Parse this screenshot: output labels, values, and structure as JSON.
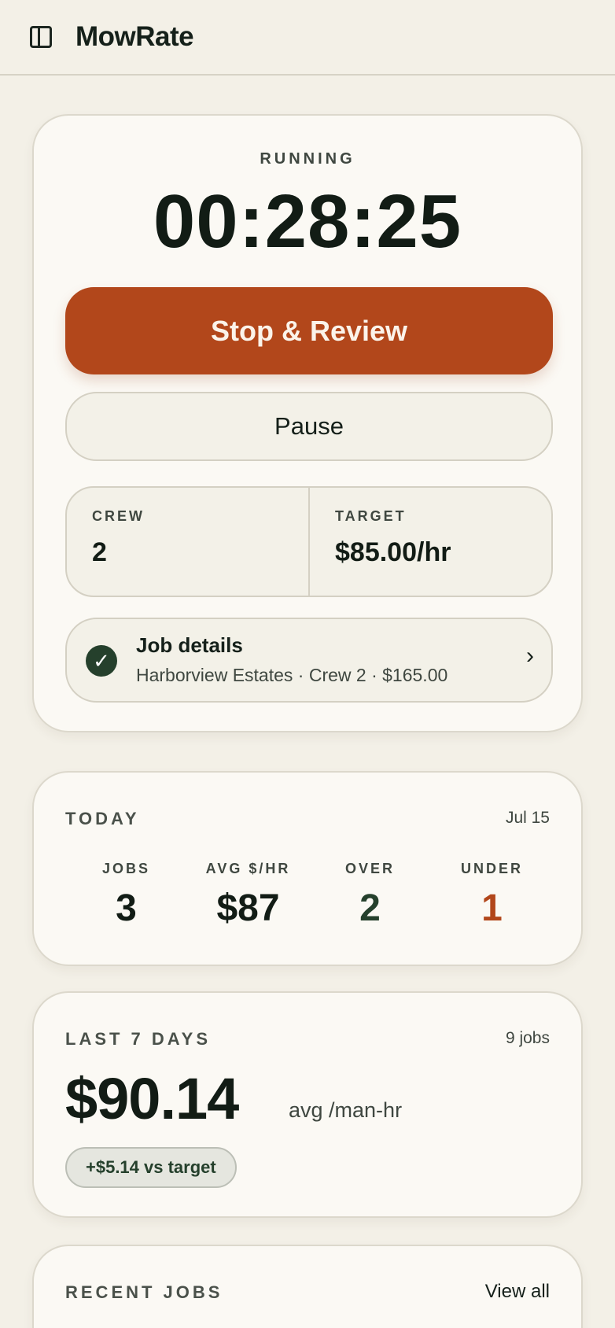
{
  "header": {
    "title": "MowRate",
    "sidebar_icon": "sidebar-toggle-icon"
  },
  "timer": {
    "status": "RUNNING",
    "elapsed": "00:28:25",
    "stop_label": "Stop & Review",
    "pause_label": "Pause",
    "crew_label": "CREW",
    "crew_value": "2",
    "target_label": "TARGET",
    "target_value": "$85.00/hr",
    "job_details": {
      "title": "Job details",
      "subtitle": "Harborview Estates · Crew 2 · $165.00",
      "check_glyph": "✓",
      "chevron_glyph": "›"
    }
  },
  "today": {
    "title": "TODAY",
    "date": "Jul 15",
    "kpis": [
      {
        "label": "JOBS",
        "value": "3"
      },
      {
        "label": "AVG $/HR",
        "value": "$87"
      },
      {
        "label": "OVER",
        "value": "2"
      },
      {
        "label": "UNDER",
        "value": "1"
      }
    ]
  },
  "last7": {
    "title": "LAST 7 DAYS",
    "jobs": "9 jobs",
    "value": "$90.14",
    "unit": "avg /man-hr",
    "delta": "+$5.14 vs target"
  },
  "recent": {
    "title": "RECENT JOBS",
    "view_all": "View all"
  },
  "colors": {
    "accent": "#b2471b",
    "green": "#25402c",
    "background": "#f3f0e7"
  }
}
